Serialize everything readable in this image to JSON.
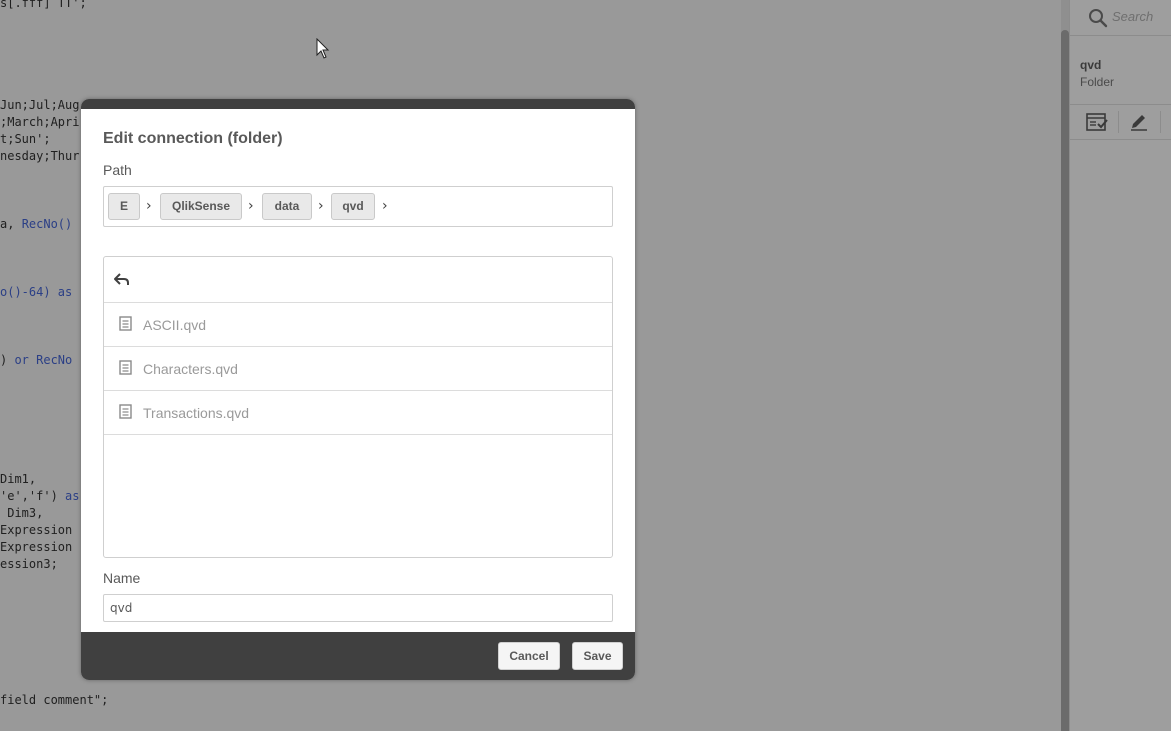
{
  "editor": {
    "lines": [
      {
        "text": "s[.fff] TT';",
        "kw": ""
      },
      {
        "text": "Jun;Jul;Aug",
        "kw": ""
      },
      {
        "text": ";March;Apri",
        "kw": ""
      },
      {
        "text": "t;Sun';",
        "kw": ""
      },
      {
        "text": "nesday;Thur",
        "kw": ""
      },
      {
        "text": "a, ",
        "kw": "RecNo()"
      },
      {
        "text": "",
        "kw": "o()-64) as"
      },
      {
        "text": ") ",
        "kw": "or RecNo"
      },
      {
        "text": "Dim1,",
        "kw": ""
      },
      {
        "text": "'e','f') ",
        "kw": "as"
      },
      {
        "text": " Dim3,",
        "kw": ""
      },
      {
        "text": "Expression",
        "kw": ""
      },
      {
        "text": "Expression",
        "kw": ""
      },
      {
        "text": "ession3;",
        "kw": ""
      },
      {
        "text": "field comment\";",
        "kw": ""
      }
    ]
  },
  "right_panel": {
    "search_placeholder": "Search",
    "search_icon": "search-icon",
    "connection_name": "qvd",
    "connection_type": "Folder",
    "actions": [
      "select-data-icon",
      "edit-icon"
    ]
  },
  "dialog": {
    "title": "Edit connection (folder)",
    "path_label": "Path",
    "path_crumbs": [
      "E",
      "QlikSense",
      "data",
      "qvd"
    ],
    "back_icon": "back-arrow-icon",
    "files": [
      "ASCII.qvd",
      "Characters.qvd",
      "Transactions.qvd"
    ],
    "name_label": "Name",
    "name_value": "qvd",
    "cancel_label": "Cancel",
    "save_label": "Save"
  },
  "colors": {
    "overlay": "#999999",
    "dialog_bar": "#404040",
    "text": "#595959"
  }
}
